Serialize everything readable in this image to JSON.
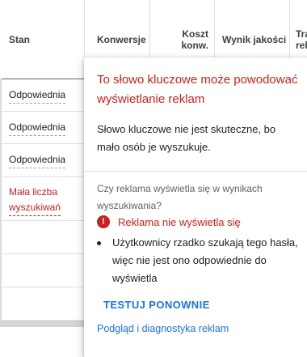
{
  "table": {
    "headers": {
      "status": "Stan",
      "conversions": "Konwersje",
      "cost_per_conv": "Koszt konw.",
      "quality_score": "Wynik jakości",
      "traffic": "Tra rek"
    },
    "rows": [
      {
        "status": "Odpowiednia",
        "low": false
      },
      {
        "status": "Odpowiednia",
        "low": false
      },
      {
        "status": "Odpowiednia",
        "low": false
      },
      {
        "status": "Mała liczba wyszukiwań",
        "low": true
      }
    ],
    "status_line1": [
      "Odpowiednia",
      "Odpowiednia",
      "Odpowiednia",
      "Mała liczba"
    ],
    "status_line2": "wyszukiwań"
  },
  "popup": {
    "title": "To słowo kluczowe może powodować wyświetlanie reklam",
    "description": "Słowo kluczowe nie jest skuteczne, bo mało osób je wyszukuje.",
    "question": "Czy reklama wyświetla się w wynikach wyszukiwania?",
    "result_icon": "!",
    "result": "Reklama nie wyświetla się",
    "bullet": "Użytkownicy rzadko szukają tego hasła, więc nie jest ono odpowiednie do wyświetla",
    "retry_label": "TESTUJ PONOWNIE",
    "preview_link": "Podgląd i diagnostyka reklam"
  },
  "colors": {
    "error": "#c5221f",
    "link": "#1a73e8",
    "text": "#202124"
  }
}
